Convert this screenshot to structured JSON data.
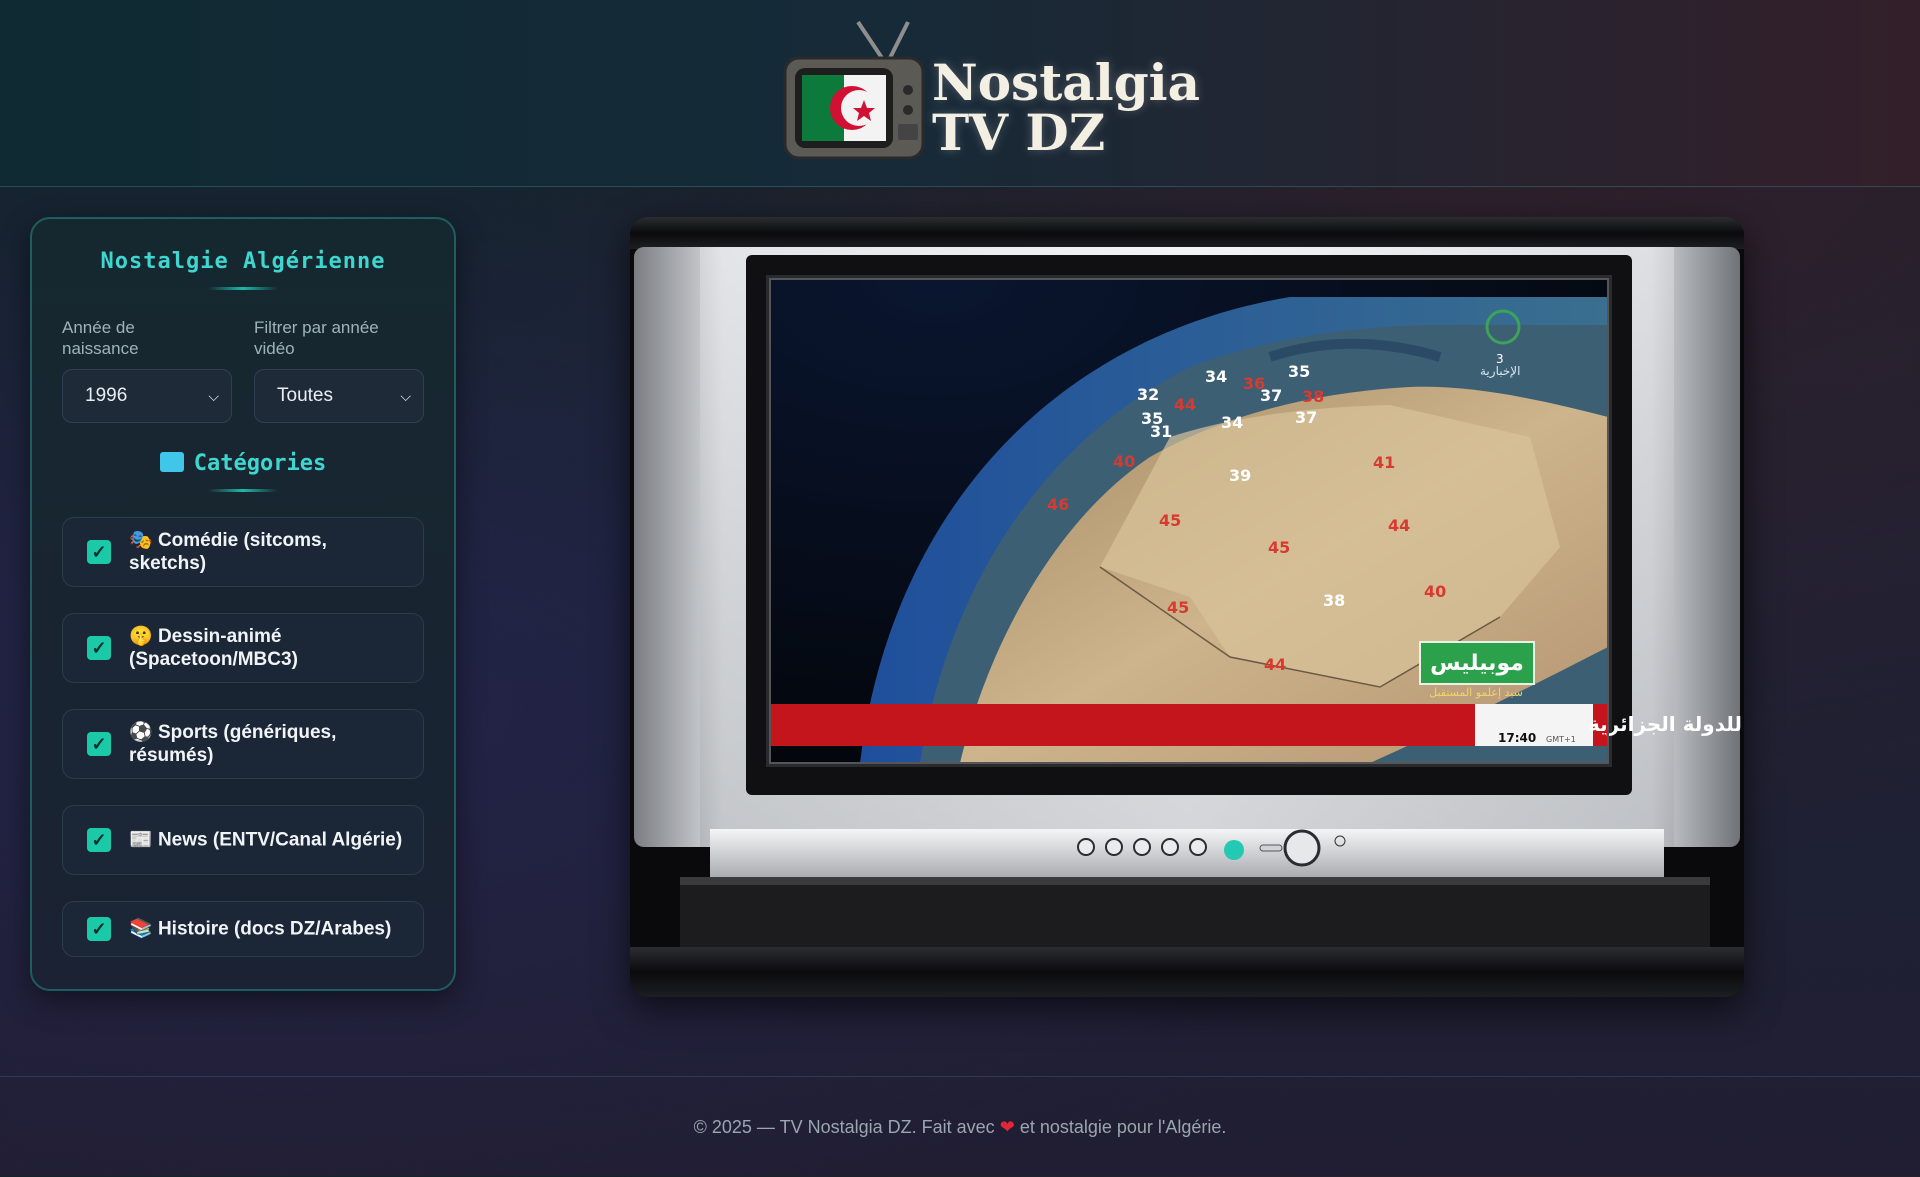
{
  "header": {
    "logo_line1": "Nostalgia",
    "logo_line2": "TV DZ",
    "logo_icon": "retro-tv-algeria-flag-icon"
  },
  "panel": {
    "title": "Nostalgie Algérienne",
    "birth_year_label": "Année de naissance",
    "birth_year_value": "1996",
    "video_year_label": "Filtrer par année vidéo",
    "video_year_value": "Toutes",
    "categories_title": "Catégories",
    "categories_icon": "tv-icon",
    "categories": [
      {
        "emoji": "🎭",
        "label": "Comédie (sitcoms, sketchs)",
        "checked": true
      },
      {
        "emoji": "🤫",
        "label": "Dessin-animé (Spacetoon/MBC3)",
        "checked": true
      },
      {
        "emoji": "⚽",
        "label": "Sports (génériques, résumés)",
        "checked": true
      },
      {
        "emoji": "📰",
        "label": "News (ENTV/Canal Algérie)",
        "checked": true
      },
      {
        "emoji": "📚",
        "label": "Histoire (docs DZ/Arabes)",
        "checked": true
      }
    ]
  },
  "tv": {
    "ticker_text": "هام • جانية عددا من الأملاك العقارية التابعة للدولة الجزائرية",
    "clock": "17:40",
    "timezone": "GMT+1",
    "sponsor": "موبيليس",
    "sponsor_tagline": "سيد إعلمو المستقبل",
    "channel_logo": "الإخبارية",
    "channel_number": "3",
    "temperatures": [
      "34",
      "35",
      "32",
      "44",
      "36",
      "37",
      "38",
      "35",
      "31",
      "34",
      "37",
      "40",
      "39",
      "41",
      "46",
      "45",
      "44",
      "45",
      "45",
      "38",
      "40",
      "44"
    ]
  },
  "footer": {
    "text_before": "© 2025 — TV Nostalgia DZ. Fait avec",
    "heart": "❤",
    "text_after": "et nostalgie pour l'Algérie."
  }
}
